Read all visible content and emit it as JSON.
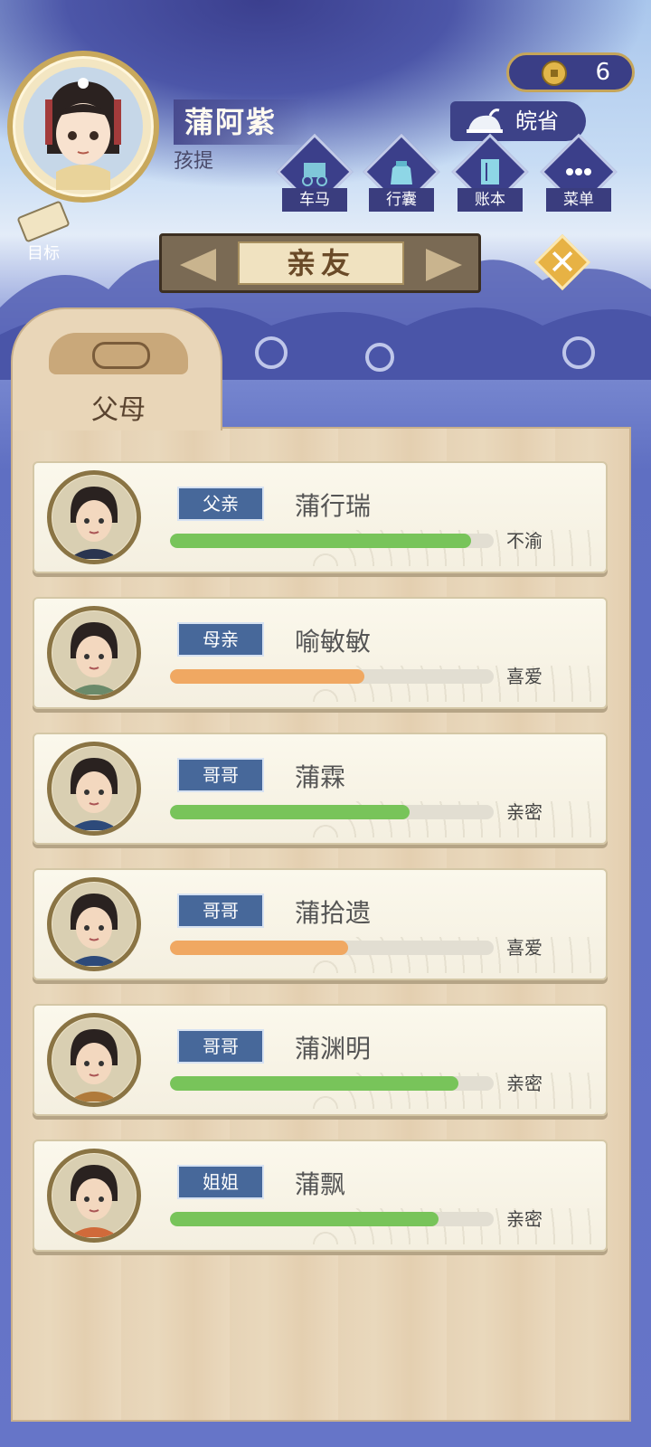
{
  "player": {
    "name": "蒲阿紫",
    "subtitle": "孩提"
  },
  "currency": {
    "icon": "coin-icon",
    "amount": "6"
  },
  "location": {
    "icon": "iron-icon",
    "province": "皖省"
  },
  "menu": [
    {
      "label": "车马",
      "icon": "carriage-icon"
    },
    {
      "label": "行囊",
      "icon": "bag-icon"
    },
    {
      "label": "账本",
      "icon": "ledger-icon"
    },
    {
      "label": "菜单",
      "icon": "more-icon"
    }
  ],
  "goal": {
    "label": "目标",
    "icon": "scroll-icon"
  },
  "screen": {
    "title": "亲友",
    "close_icon": "close-icon"
  },
  "tabs": [
    {
      "label": "父母"
    }
  ],
  "relatives": [
    {
      "relation": "父亲",
      "name": "蒲行瑞",
      "status": "不渝",
      "affinity": 0.93,
      "bar_color": "#78c45a"
    },
    {
      "relation": "母亲",
      "name": "喻敏敏",
      "status": "喜爱",
      "affinity": 0.6,
      "bar_color": "#f0a862"
    },
    {
      "relation": "哥哥",
      "name": "蒲霖",
      "status": "亲密",
      "affinity": 0.74,
      "bar_color": "#78c45a"
    },
    {
      "relation": "哥哥",
      "name": "蒲拾遗",
      "status": "喜爱",
      "affinity": 0.55,
      "bar_color": "#f0a862"
    },
    {
      "relation": "哥哥",
      "name": "蒲渊明",
      "status": "亲密",
      "affinity": 0.89,
      "bar_color": "#78c45a"
    },
    {
      "relation": "姐姐",
      "name": "蒲飘",
      "status": "亲密",
      "affinity": 0.83,
      "bar_color": "#78c45a"
    }
  ]
}
